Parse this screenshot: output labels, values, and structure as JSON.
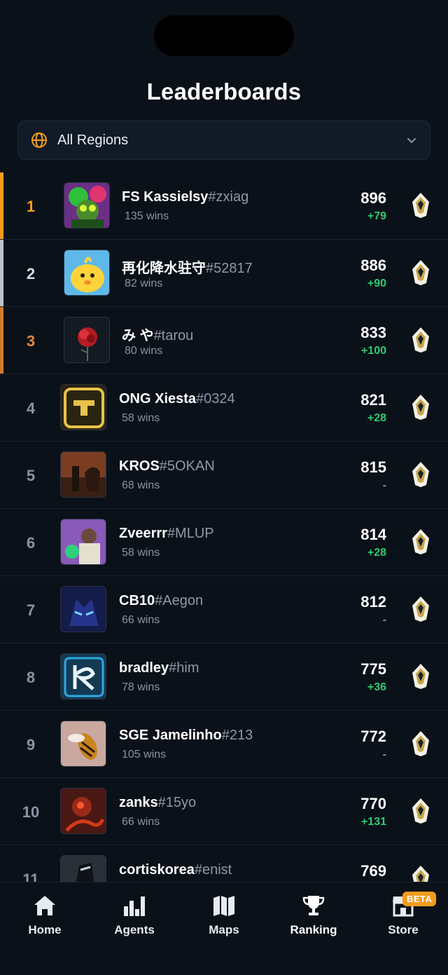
{
  "title": "Leaderboards",
  "region": {
    "label": "All Regions",
    "icon": "globe-icon"
  },
  "colors": {
    "gold": "#f29c1f",
    "silver": "#b9c4d0",
    "bronze": "#d27a2c",
    "positive": "#2ecc71"
  },
  "players": [
    {
      "rank": "1",
      "name": "FS Kassielsy",
      "tag": "#zxiag",
      "wins": "135 wins",
      "score": "896",
      "delta": "+79"
    },
    {
      "rank": "2",
      "name": "再化降水驻守",
      "tag": "#52817",
      "wins": "82 wins",
      "score": "886",
      "delta": "+90"
    },
    {
      "rank": "3",
      "name": "み や",
      "tag": "#tarou",
      "wins": "80 wins",
      "score": "833",
      "delta": "+100"
    },
    {
      "rank": "4",
      "name": "ONG Xiesta",
      "tag": "#0324",
      "wins": "58 wins",
      "score": "821",
      "delta": "+28"
    },
    {
      "rank": "5",
      "name": "KROS",
      "tag": "#5OKAN",
      "wins": "68 wins",
      "score": "815",
      "delta": "-"
    },
    {
      "rank": "6",
      "name": "Zveerrr",
      "tag": "#MLUP",
      "wins": "58 wins",
      "score": "814",
      "delta": "+28"
    },
    {
      "rank": "7",
      "name": "CB10",
      "tag": "#Aegon",
      "wins": "66 wins",
      "score": "812",
      "delta": "-"
    },
    {
      "rank": "8",
      "name": "bradley",
      "tag": "#him",
      "wins": "78 wins",
      "score": "775",
      "delta": "+36"
    },
    {
      "rank": "9",
      "name": "SGE Jamelinho",
      "tag": "#213",
      "wins": "105 wins",
      "score": "772",
      "delta": "-"
    },
    {
      "rank": "10",
      "name": "zanks",
      "tag": "#15yo",
      "wins": "66 wins",
      "score": "770",
      "delta": "+131"
    },
    {
      "rank": "11",
      "name": "cortiskorea",
      "tag": "#enist",
      "wins": "",
      "score": "769",
      "delta": ""
    }
  ],
  "tabs": [
    {
      "label": "Home",
      "icon": "home-icon"
    },
    {
      "label": "Agents",
      "icon": "bar-chart-icon"
    },
    {
      "label": "Maps",
      "icon": "map-icon"
    },
    {
      "label": "Ranking",
      "icon": "trophy-icon"
    },
    {
      "label": "Store",
      "icon": "store-icon",
      "badge": "BETA"
    }
  ]
}
